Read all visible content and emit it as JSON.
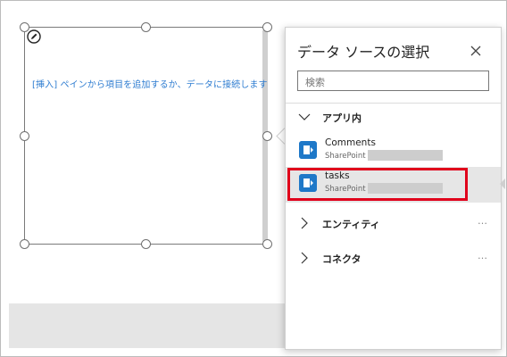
{
  "gallery": {
    "placeholder_text": "[挿入] ペインから項目を追加するか、データに接続します"
  },
  "panel": {
    "title": "データ ソースの選択",
    "search": {
      "placeholder": "検索",
      "value": "検索"
    },
    "groups": {
      "in_app": {
        "label": "アプリ内",
        "items": [
          {
            "name": "Comments",
            "source": "SharePoint -"
          },
          {
            "name": "tasks",
            "source": "SharePoint -"
          }
        ]
      },
      "entities": {
        "label": "エンティティ",
        "more": "…"
      },
      "connectors": {
        "label": "コネクタ",
        "more": "…"
      }
    }
  },
  "colors": {
    "accent_text": "#2f7dd1",
    "icon_blue": "#1e78c8",
    "highlight_red": "#e0001b",
    "selected_bg": "#e6e6e6"
  },
  "icons": {
    "edit": "pencil-icon",
    "close": "close-icon",
    "expand": "chevron-down-icon",
    "collapse": "chevron-right-icon",
    "datasource": "sharepoint-list-icon"
  }
}
